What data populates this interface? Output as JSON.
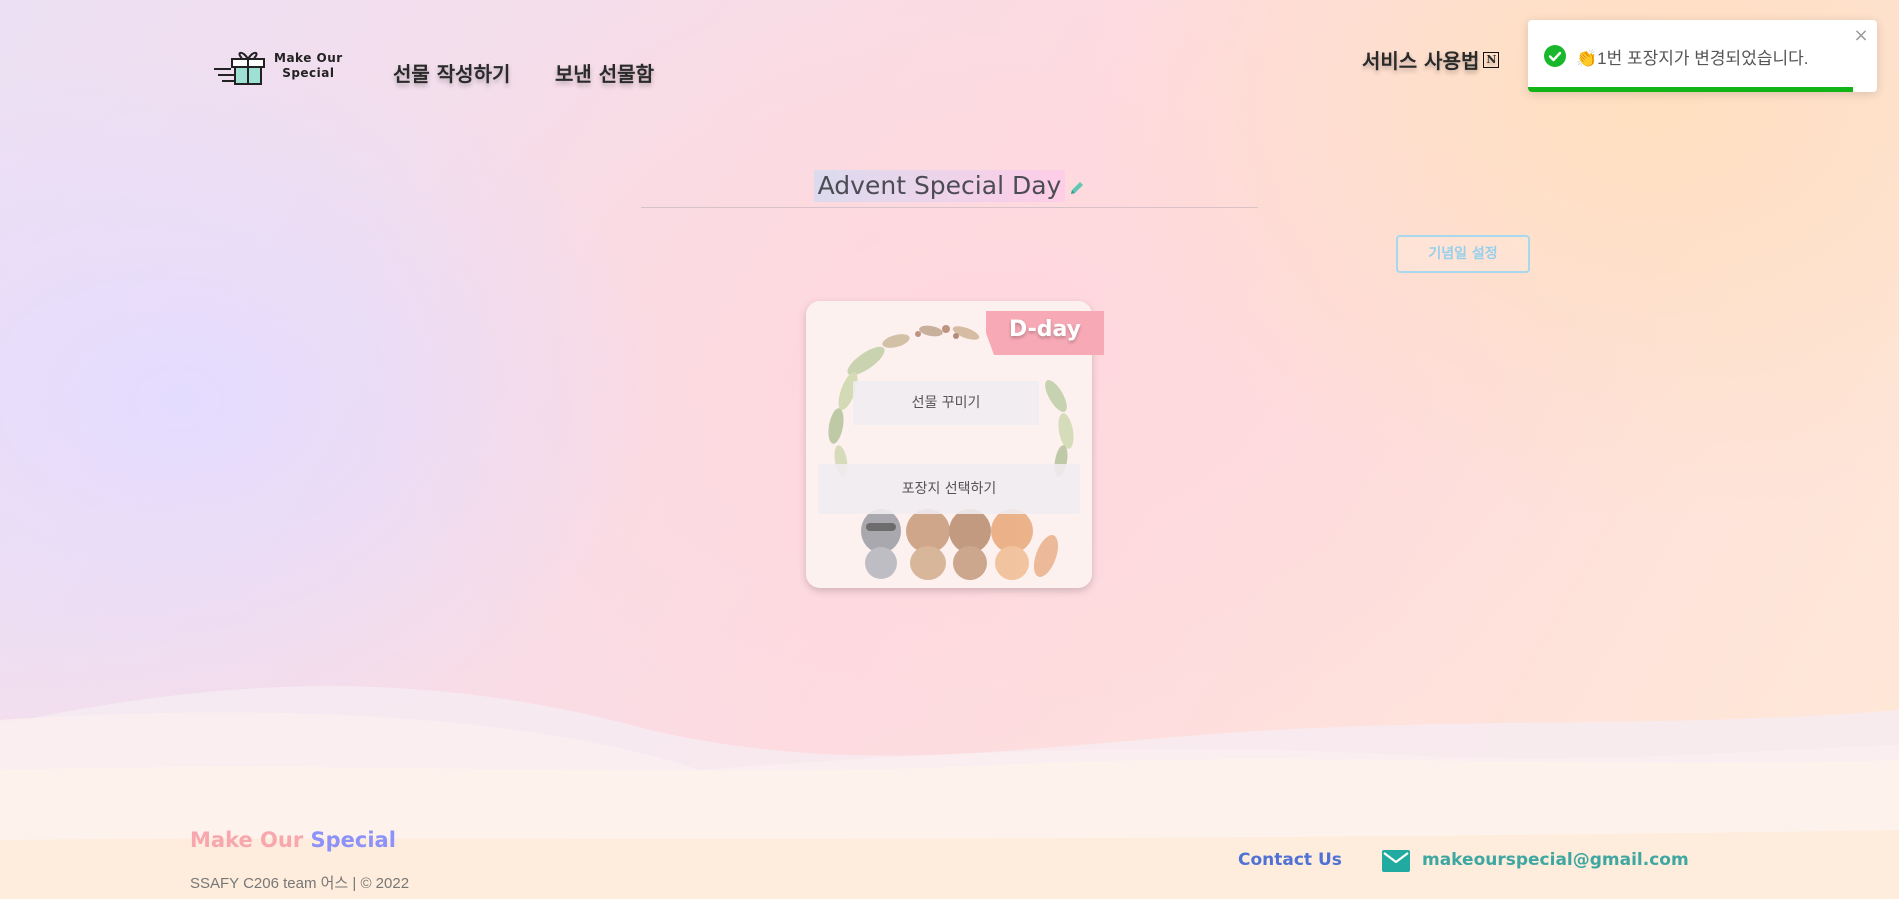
{
  "header": {
    "logo_line1": "Make Our",
    "logo_line2": "Special",
    "nav_create": "선물 작성하기",
    "nav_sent": "보낸 선물함",
    "nav_guide": "서비스 사용법",
    "notion_icon_glyph": "N"
  },
  "toast": {
    "message": "👏1번 포장지가 변경되었습니다.",
    "close_glyph": "×",
    "progress_percent": 93,
    "accent": "#10b417"
  },
  "main": {
    "title": "Advent Special Day",
    "anniversary_button": "기념일 설정"
  },
  "card": {
    "ribbon_label": "D-day",
    "decorate_button": "선물 꾸미기",
    "wrap_button": "포장지 선택하기"
  },
  "footer": {
    "brand_part1": "Make Our",
    "brand_part2": "Special",
    "copyright": "SSAFY C206 team 어스 | © 2022",
    "contact_label": "Contact Us",
    "email": "makeourspecial@gmail.com"
  },
  "colors": {
    "brand_pink": "#f7a8ae",
    "brand_purple": "#8c92f8",
    "contact_blue": "#4f72d4",
    "email_teal": "#3fa7a1",
    "anniversary_border": "#a7d8ee",
    "ribbon": "#f7a9b6"
  },
  "icons": [
    "gift-logo-icon",
    "notion-icon",
    "check-circle-icon",
    "close-icon",
    "pencil-icon",
    "mail-icon"
  ]
}
